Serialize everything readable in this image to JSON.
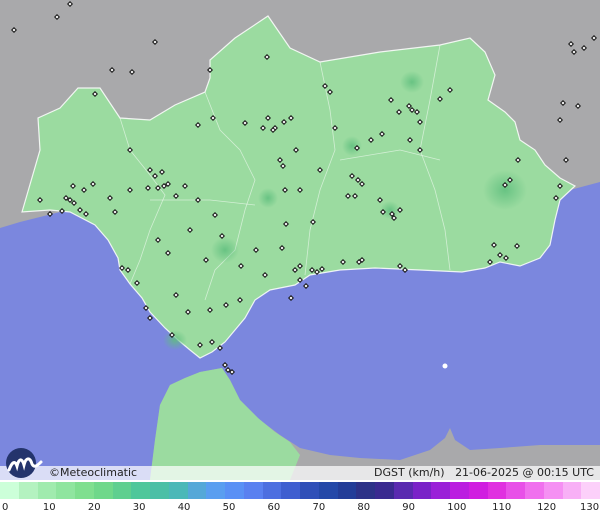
{
  "brand": {
    "logo_icon": "meteoclimatic-logo-icon",
    "name": "©Meteoclimatic"
  },
  "product": {
    "variable": "DGST (km/h)",
    "timestamp": "21-06-2025 @ 00:15 UTC"
  },
  "legend": {
    "ticks": [
      "0",
      "10",
      "20",
      "30",
      "40",
      "50",
      "60",
      "70",
      "80",
      "90",
      "100",
      "110",
      "120",
      "130"
    ],
    "colors": [
      "#ccffd9",
      "#b4f2c0",
      "#a0ebae",
      "#8fe59f",
      "#7fdf8f",
      "#6fd88a",
      "#5fcf8f",
      "#4fc79a",
      "#4bbfa6",
      "#4bb8b8",
      "#55a8d8",
      "#5a9ef0",
      "#5a90f5",
      "#5a80f0",
      "#4d6ee0",
      "#3f5ed0",
      "#2f4fb8",
      "#2448a8",
      "#233d98",
      "#2d3288",
      "#3a2a90",
      "#5a2ab0",
      "#7a22c8",
      "#9a20d8",
      "#bb1ee0",
      "#d01ee0",
      "#e030e0",
      "#e850e8",
      "#f070ee",
      "#f590f3",
      "#f8b0f6",
      "#fcd0fa"
    ],
    "colors_meaning": "gust speed colour scale from calm (light green) to very strong (pink)"
  },
  "map": {
    "colors": {
      "sea": "#7b87de",
      "land_outside": "#a9a9ab",
      "region_fill": "#9bdba0",
      "station": "#111111"
    },
    "station_icon": "station-diamond-icon"
  }
}
